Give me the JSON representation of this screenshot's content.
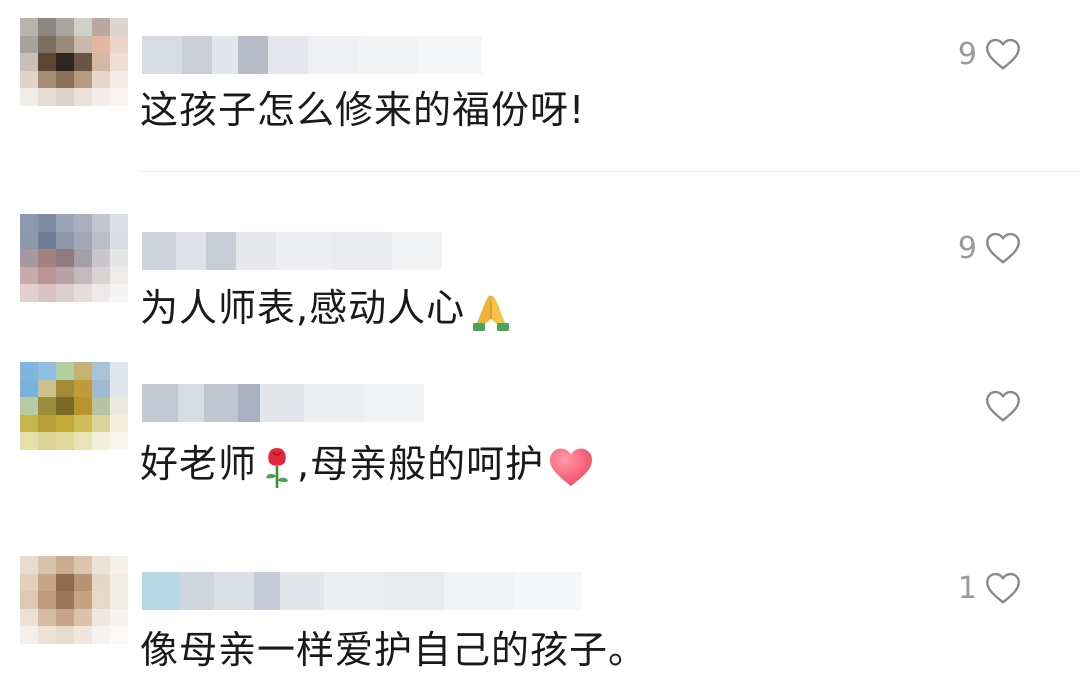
{
  "comments": [
    {
      "text": "这孩子怎么修来的福份呀!",
      "likes": "9",
      "emoji": ""
    },
    {
      "text": "为人师表,感动人心",
      "likes": "9",
      "emoji": "folded-hands"
    },
    {
      "text_a": "好老师",
      "text_b": ",母亲般的呵护",
      "likes": "",
      "emoji": "rose",
      "emoji_end": "heart"
    },
    {
      "text": "像母亲一样爱护自己的孩子。",
      "likes": "1",
      "emoji": ""
    }
  ],
  "icons": {
    "like": "heart-outline-icon"
  }
}
